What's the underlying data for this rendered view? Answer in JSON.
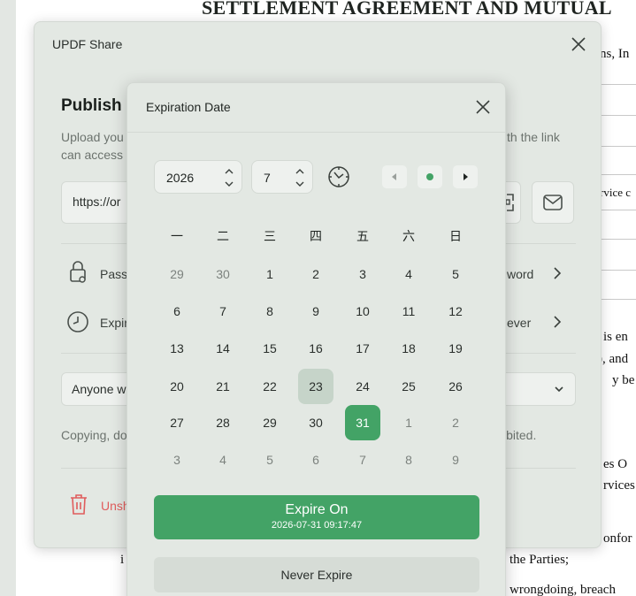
{
  "document": {
    "title": "SETTLEMENT AGREEMENT AND MUTUAL",
    "fragments": [
      "ns, In",
      "rvice c",
      "is en",
      "), and",
      "y be",
      "es O",
      "rvices",
      "onfor",
      "i",
      "the Parties;",
      "wrongdoing, breach"
    ]
  },
  "share_dialog": {
    "title": "UPDF Share",
    "publish_heading": "Publish",
    "description_line1_left": "Upload you",
    "description_line1_right": "th the link",
    "description_line2_left": "can access",
    "link_value": "https://or",
    "password_label": "Pass",
    "password_value": "word",
    "expire_label": "Expir",
    "expire_value": "ever",
    "access_value": "Anyone w",
    "copy_notice_left": "Copying, do",
    "copy_notice_right": "ibited.",
    "unshare_label": "Unsh"
  },
  "expiration_popup": {
    "title": "Expiration Date",
    "year": "2026",
    "month": "7",
    "weekdays": [
      "一",
      "二",
      "三",
      "四",
      "五",
      "六",
      "日"
    ],
    "weeks": [
      [
        "29",
        "30",
        "1",
        "2",
        "3",
        "4",
        "5"
      ],
      [
        "6",
        "7",
        "8",
        "9",
        "10",
        "11",
        "12"
      ],
      [
        "13",
        "14",
        "15",
        "16",
        "17",
        "18",
        "19"
      ],
      [
        "20",
        "21",
        "22",
        "23",
        "24",
        "25",
        "26"
      ],
      [
        "27",
        "28",
        "29",
        "30",
        "31",
        "1",
        "2"
      ],
      [
        "3",
        "4",
        "5",
        "6",
        "7",
        "8",
        "9"
      ]
    ],
    "today_day": "23",
    "selected_day": "31",
    "expire_on_label": "Expire On",
    "expire_on_datetime": "2026-07-31 09:17:47",
    "never_expire_label": "Never Expire"
  },
  "colors": {
    "accent": "#43a366",
    "today_bg": "#c6d4c9",
    "danger": "#e05c5c"
  }
}
